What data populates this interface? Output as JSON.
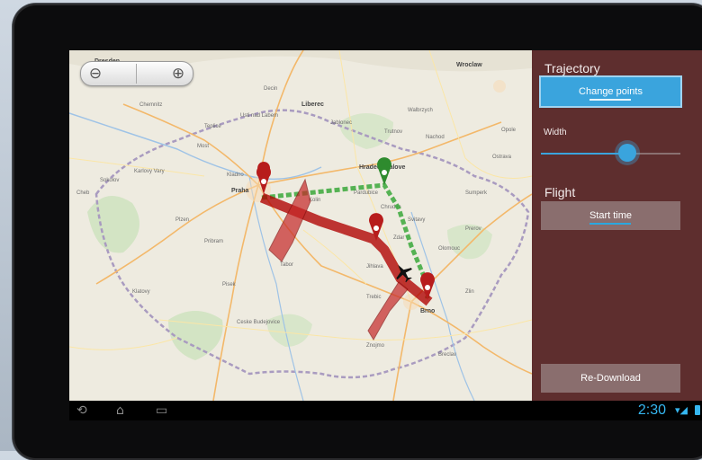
{
  "panel": {
    "trajectory_heading": "Trajectory",
    "change_points_label": "Change points",
    "width_label": "Width",
    "width_value": 0.62,
    "flight_heading": "Flight",
    "start_time_label": "Start time",
    "redownload_label": "Re-Download"
  },
  "map": {
    "zoom_out_icon": "zoom-out-icon",
    "zoom_in_icon": "zoom-in-icon",
    "places": [
      "Dresden",
      "Wroclaw",
      "Chemnitz",
      "Liberec",
      "Walbrzych",
      "Most",
      "Karlovy Vary",
      "Hradec Kralove",
      "Pardubice",
      "Praha",
      "Kladno",
      "Jihlava",
      "Olomouc",
      "Brno",
      "Ostrava",
      "Ceske Budejovice",
      "Plzen",
      "Zlin",
      "Tabor",
      "Pisek",
      "Opole",
      "Jablonec",
      "Trutnov",
      "Teplice",
      "Usti nad Labem",
      "Kolin",
      "Chrudim",
      "Pribram",
      "Zdar",
      "Trebic",
      "Znojmo",
      "Breclav",
      "Prerov",
      "Svitavy",
      "Klatovy",
      "Cheb",
      "Sokolov",
      "Decin",
      "Nachod",
      "Sumperk"
    ],
    "colors": {
      "trajectory_red": "#b00000",
      "trajectory_green": "#3aa83a",
      "plane_black": "#111111"
    }
  },
  "nav": {
    "back_icon": "back-icon",
    "home_icon": "home-icon",
    "recents_icon": "recent-apps-icon",
    "clock": "2:30",
    "wifi_icon": "wifi-icon",
    "signal_icon": "signal-icon",
    "battery_icon": "battery-icon"
  }
}
